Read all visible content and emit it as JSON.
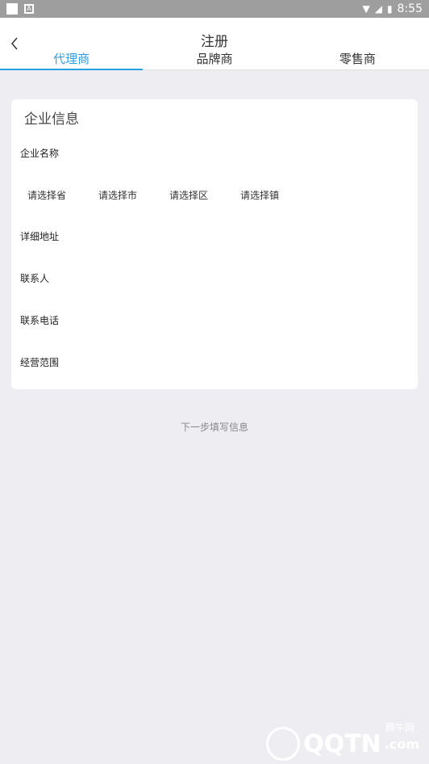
{
  "status_bar": {
    "time": "8:55"
  },
  "header": {
    "title": "注册"
  },
  "tabs": [
    {
      "label": "代理商",
      "active": true
    },
    {
      "label": "品牌商",
      "active": false
    },
    {
      "label": "零售商",
      "active": false
    }
  ],
  "card": {
    "title": "企业信息",
    "company_name_label": "企业名称",
    "region": {
      "province": "请选择省",
      "city": "请选择市",
      "district": "请选择区",
      "town": "请选择镇"
    },
    "address_label": "详细地址",
    "contact_label": "联系人",
    "phone_label": "联系电话",
    "scope_label": "经营范围"
  },
  "next_step": "下一步填写信息",
  "watermark": {
    "brand": "QQTN",
    "suffix": ".com",
    "cn": "腾牛网"
  },
  "colors": {
    "accent": "#2aa0e6",
    "background": "#eeedf2"
  }
}
